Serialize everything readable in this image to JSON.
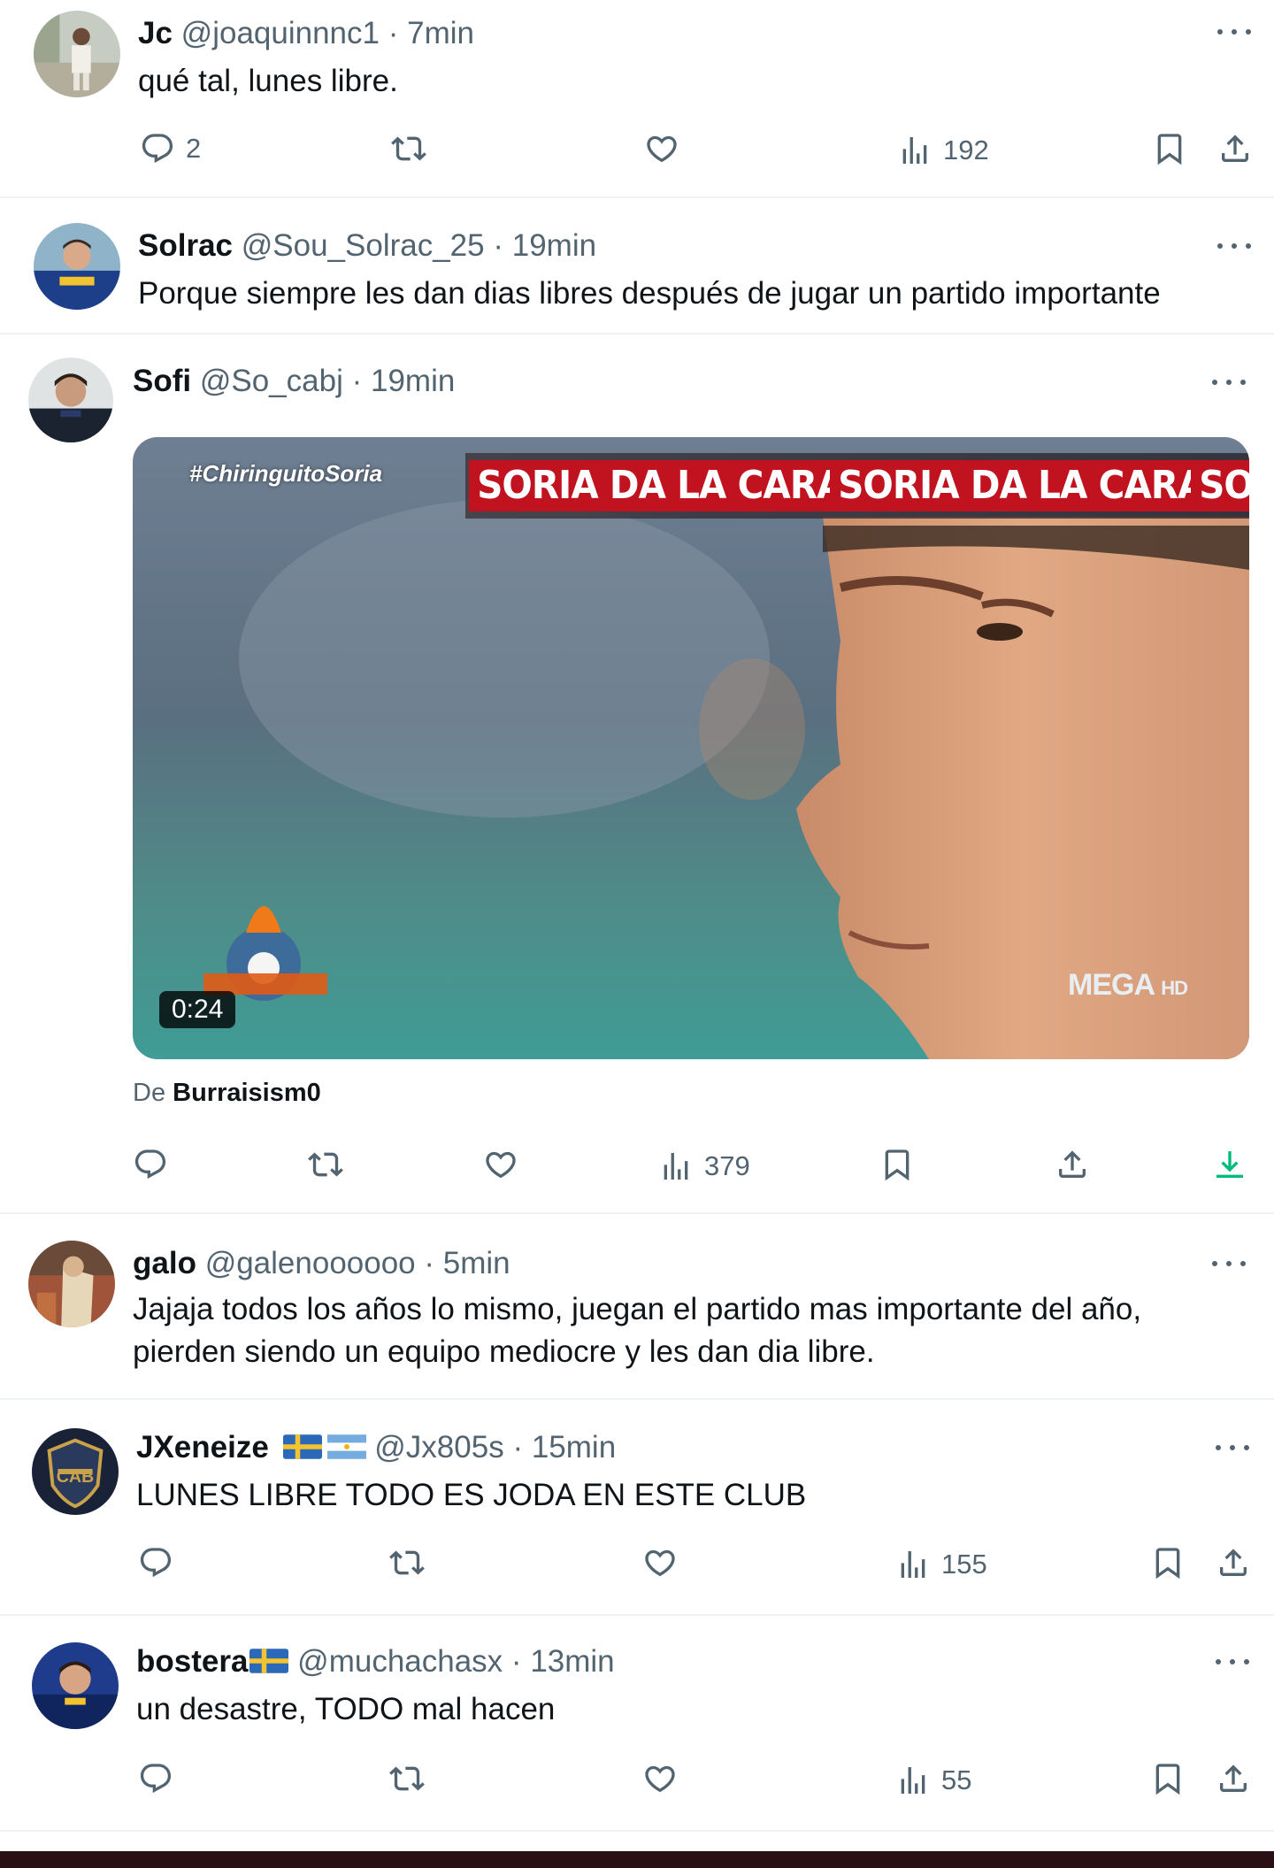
{
  "tweets": [
    {
      "name": "Jc",
      "handle": "@joaquinnnc1",
      "separator": "·",
      "time": "7min",
      "text": "qué tal, lunes libre.",
      "replies": "2",
      "views": "192"
    },
    {
      "name": "Solrac",
      "handle": "@Sou_Solrac_25",
      "separator": "·",
      "time": "19min",
      "text": "Porque siempre les dan dias libres después de jugar un partido importante"
    },
    {
      "name": "Sofi",
      "handle": "@So_cabj",
      "separator": "·",
      "time": "19min",
      "video": {
        "hashtag": "#ChiringuitoSoria",
        "chyron": [
          "SORIA DA LA CARA",
          "SORIA DA LA CARA",
          "SO"
        ],
        "duration": "0:24",
        "channel": "MEGA",
        "channel_suffix": "HD"
      },
      "source_prefix": "De",
      "source_name": "Burraisism0",
      "views": "379"
    },
    {
      "name": "galo",
      "handle": "@galenoooooo",
      "separator": "·",
      "time": "5min",
      "text_line1": "Jajaja todos los años lo mismo, juegan el partido mas importante del año,",
      "text_line2": "pierden siendo un equipo mediocre y les dan dia libre."
    },
    {
      "name": "JXeneize",
      "handle": "@Jx805s",
      "separator": "·",
      "time": "15min",
      "text": "LUNES LIBRE TODO ES JODA EN ESTE CLUB",
      "views": "155"
    },
    {
      "name": "bostera",
      "handle": "@muchachasx",
      "separator": "·",
      "time": "13min",
      "text": "un desastre, TODO mal hacen",
      "views": "55"
    }
  ],
  "colors": {
    "text": "#0f1419",
    "secondary": "#536471",
    "divider": "#eff3f4",
    "download": "#00ba7c"
  }
}
